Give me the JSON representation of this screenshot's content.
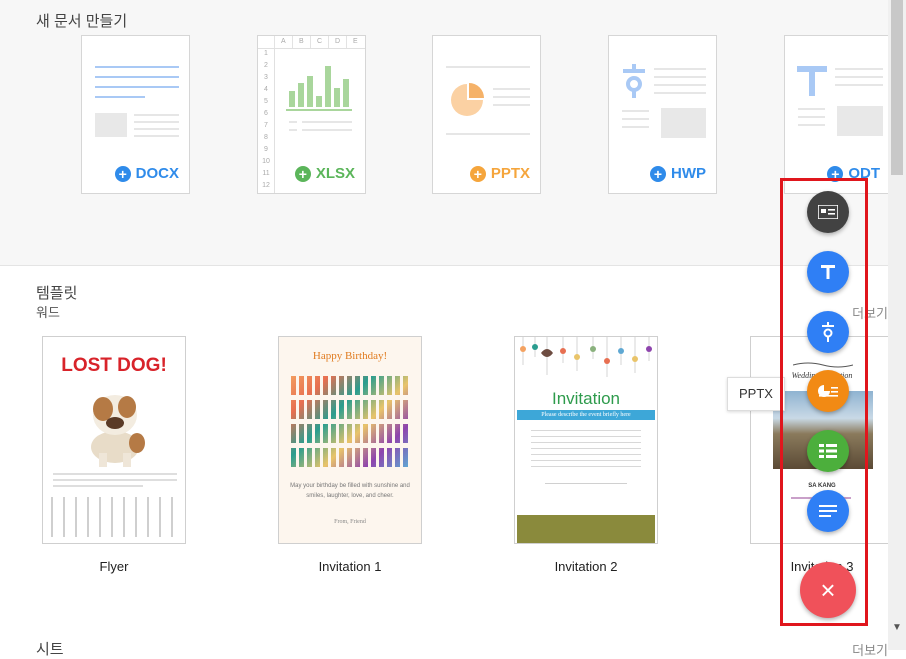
{
  "new_docs": {
    "title": "새 문서 만들기",
    "cards": [
      {
        "label": "DOCX",
        "color": "#2f8bea"
      },
      {
        "label": "XLSX",
        "color": "#5bb55a"
      },
      {
        "label": "PPTX",
        "color": "#f5a53c"
      },
      {
        "label": "HWP",
        "color": "#2f8bea"
      },
      {
        "label": "ODT",
        "color": "#2f8bea"
      }
    ],
    "xlsx_columns": [
      "A",
      "B",
      "C",
      "D",
      "E"
    ],
    "xlsx_rows": [
      "1",
      "2",
      "3",
      "4",
      "5",
      "6",
      "7",
      "8",
      "9",
      "10",
      "11",
      "12"
    ]
  },
  "templates": {
    "title": "템플릿",
    "subtitle": "워드",
    "more": "더보기",
    "items": [
      {
        "label": "Flyer"
      },
      {
        "label": "Invitation 1"
      },
      {
        "label": "Invitation 2"
      },
      {
        "label": "Invitation 3"
      }
    ],
    "flyer": {
      "headline": "LOST DOG!"
    },
    "inv1": {
      "headline": "Happy Birthday!",
      "message": "May your birthday be filled with sunshine and smiles, laughter, love, and cheer.",
      "from": "From, Friend"
    },
    "inv2": {
      "headline": "Invitation",
      "banner": "Please describe the event briefly here"
    },
    "inv3": {
      "headline": "Wedding Invitation",
      "names": "SA KANG"
    }
  },
  "sheet_section": {
    "title": "시트",
    "more": "더보기"
  },
  "fab": {
    "tooltip": "PPTX",
    "close": "×",
    "buttons": [
      {
        "name": "image-doc",
        "color": "#424242"
      },
      {
        "name": "odt",
        "color": "#2f7ff5"
      },
      {
        "name": "hwp",
        "color": "#2f7ff5"
      },
      {
        "name": "pptx",
        "color": "#f28a14"
      },
      {
        "name": "xlsx",
        "color": "#4caf3c"
      },
      {
        "name": "docx",
        "color": "#2f7ff5"
      }
    ],
    "close_color": "#f0515a",
    "highlight_color": "#e0161d"
  }
}
